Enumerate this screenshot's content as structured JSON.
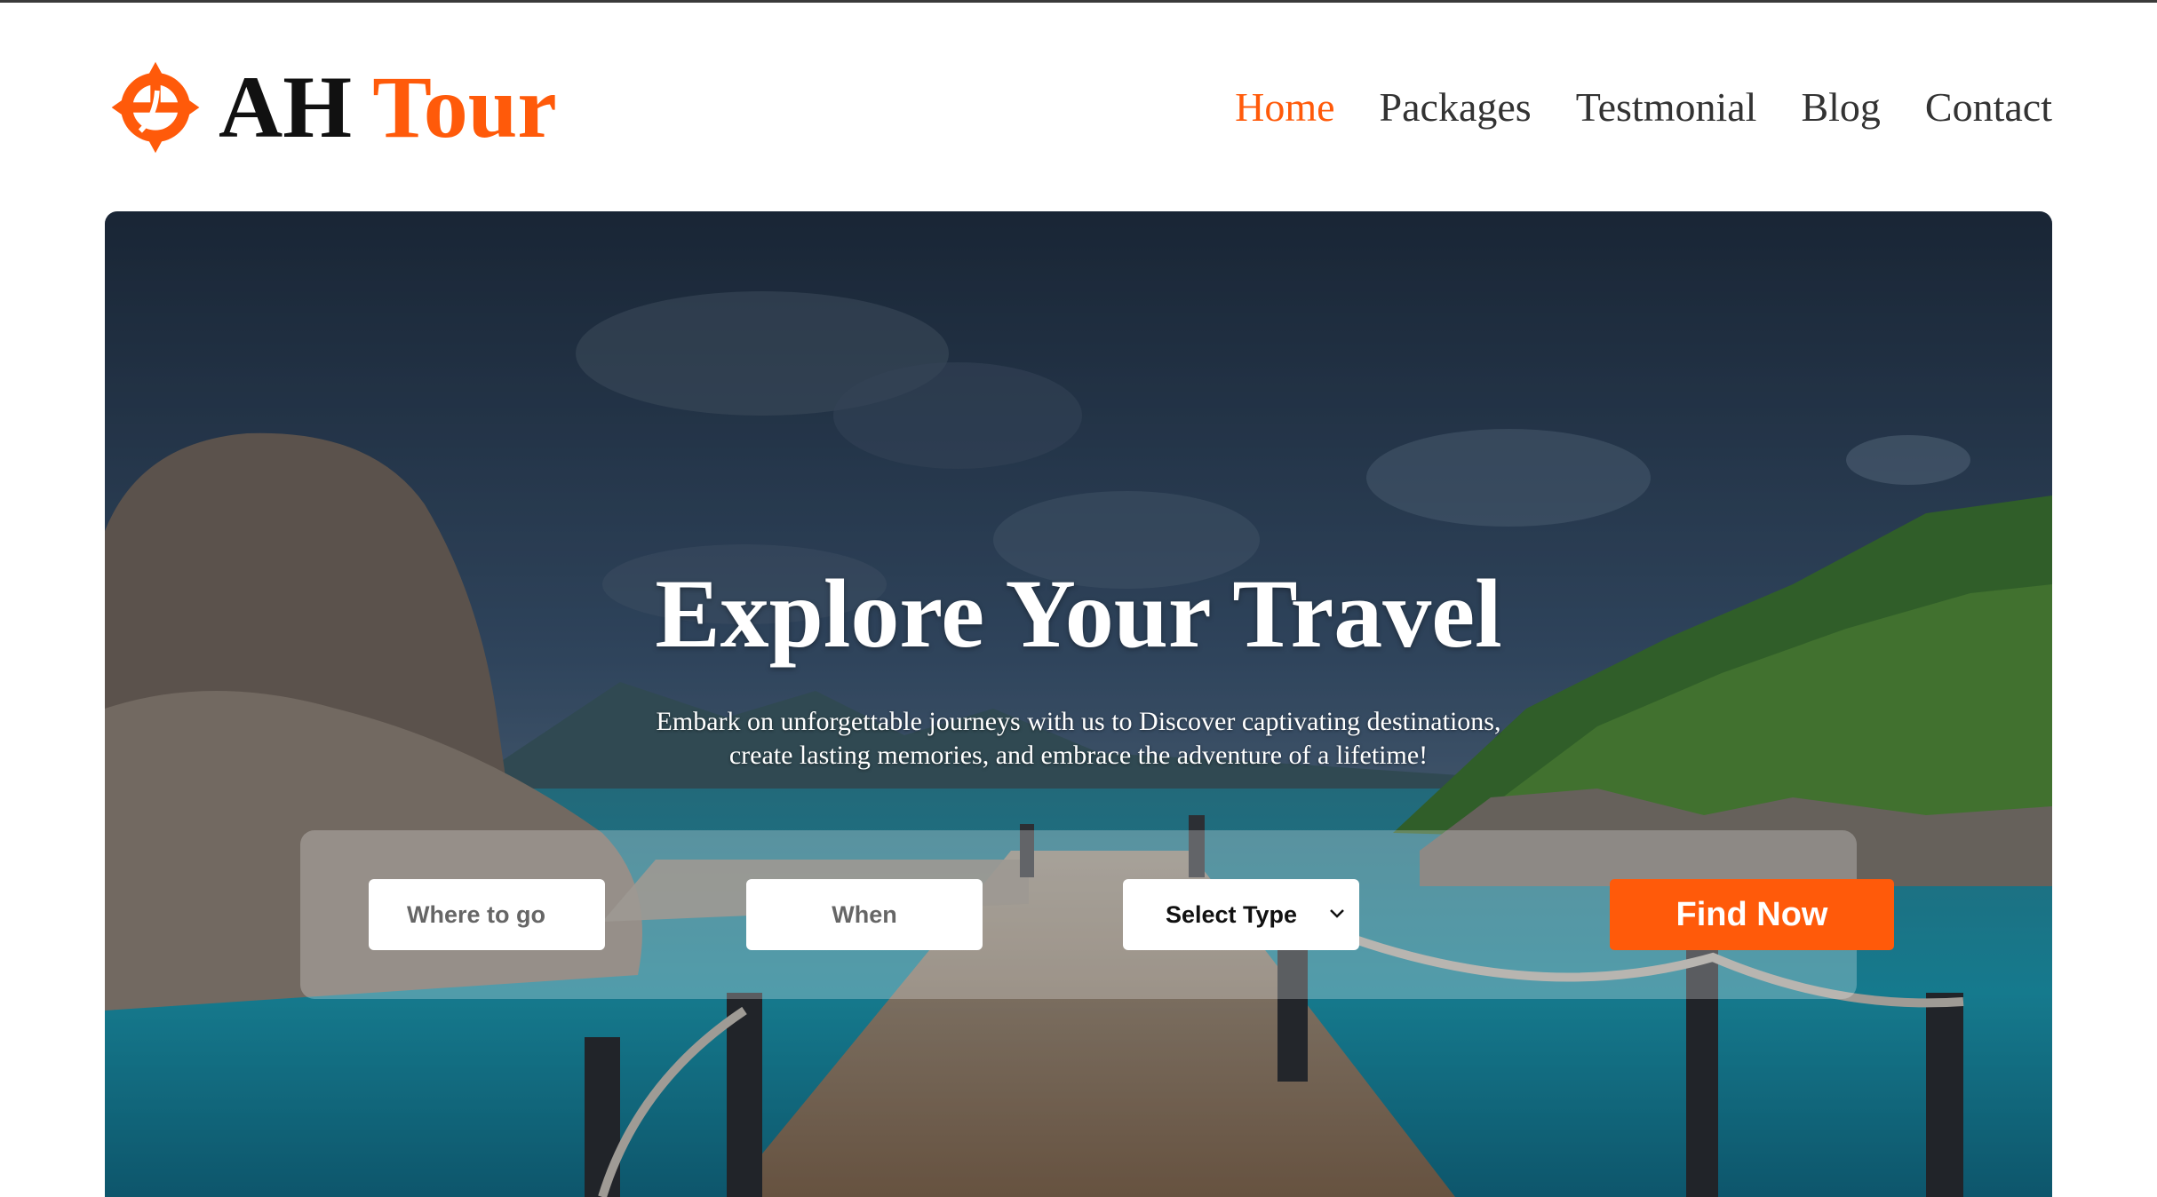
{
  "brand": {
    "name_primary": "AH",
    "name_accent": "Tour",
    "logo_icon": "compass-cross-icon",
    "accent_color": "#ff5a0a"
  },
  "nav": {
    "items": [
      {
        "label": "Home",
        "active": true
      },
      {
        "label": "Packages",
        "active": false
      },
      {
        "label": "Testmonial",
        "active": false
      },
      {
        "label": "Blog",
        "active": false
      },
      {
        "label": "Contact",
        "active": false
      }
    ]
  },
  "hero": {
    "title": "Explore Your Travel",
    "subtitle_line1": "Embark on unforgettable journeys with us to Discover captivating destinations,",
    "subtitle_line2": "create lasting memories, and embrace the adventure of a lifetime!"
  },
  "search": {
    "where_placeholder": "Where to go",
    "when_placeholder": "When",
    "type_selected": "Select Type",
    "find_label": "Find Now"
  }
}
